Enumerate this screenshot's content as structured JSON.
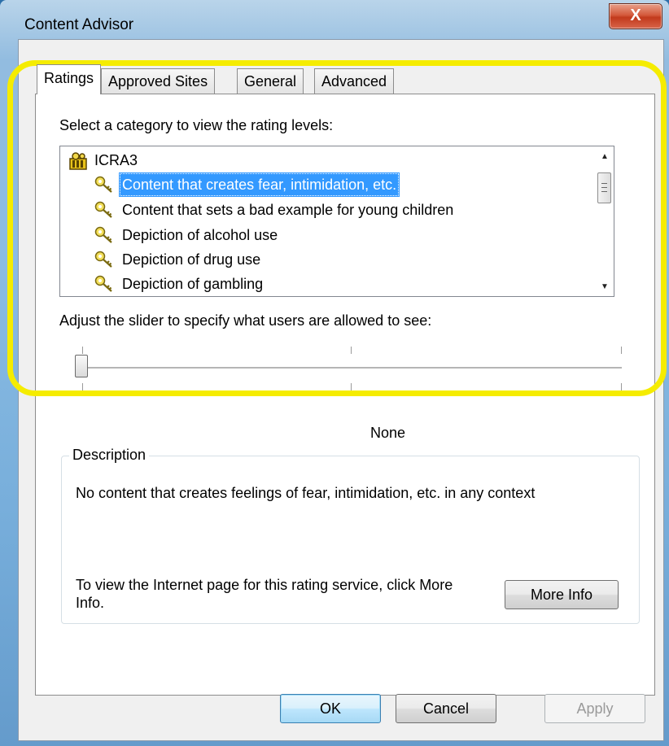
{
  "window": {
    "title": "Content Advisor",
    "close_glyph": "X"
  },
  "tabs": [
    {
      "label": "Ratings",
      "active": true
    },
    {
      "label": "Approved Sites",
      "active": false
    },
    {
      "label": "General",
      "active": false
    },
    {
      "label": "Advanced",
      "active": false
    }
  ],
  "ratings": {
    "category_prompt": "Select a category to view the rating levels:",
    "tree": {
      "root": {
        "label": "ICRA3",
        "icon": "ratings-service-icon"
      },
      "items": [
        {
          "label": "Content that creates fear, intimidation, etc.",
          "icon": "key-icon",
          "selected": true
        },
        {
          "label": "Content that sets a bad example for young children",
          "icon": "key-icon",
          "selected": false
        },
        {
          "label": "Depiction of alcohol use",
          "icon": "key-icon",
          "selected": false
        },
        {
          "label": "Depiction of drug use",
          "icon": "key-icon",
          "selected": false
        },
        {
          "label": "Depiction of gambling",
          "icon": "key-icon",
          "selected": false
        }
      ]
    },
    "slider_prompt": "Adjust the slider to specify what users are allowed to see:",
    "slider": {
      "level_index": 0,
      "level_count": 3,
      "level_label": "None"
    },
    "description": {
      "legend": "Description",
      "text": "No content that creates feelings of fear, intimidation, etc. in any context",
      "info_text": "To view the Internet page for this rating service, click More Info.",
      "more_info_label": "More Info"
    }
  },
  "buttons": {
    "ok": "OK",
    "cancel": "Cancel",
    "apply": "Apply"
  },
  "colors": {
    "selection": "#3399ff",
    "highlight_annotation": "#f5ec00",
    "close_button": "#c23a1c"
  }
}
